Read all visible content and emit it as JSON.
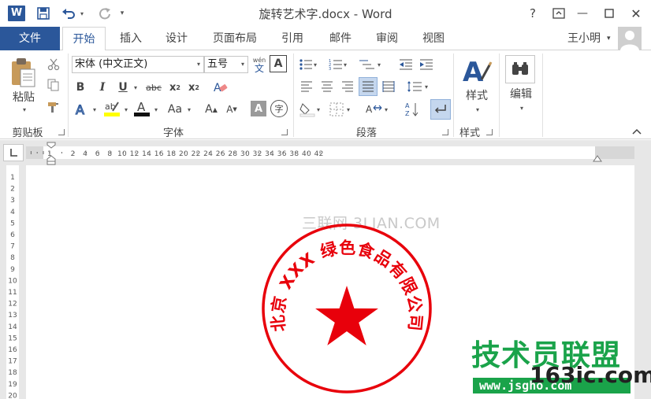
{
  "window": {
    "title": "旋转艺术字.docx - Word",
    "app_icon_letter": "W",
    "help": "?",
    "controls": {
      "minimize": "—",
      "restore": "❐",
      "close": "✕"
    }
  },
  "qat": {
    "customize": "▾"
  },
  "tabs": {
    "file": "文件",
    "items": [
      "开始",
      "插入",
      "设计",
      "页面布局",
      "引用",
      "邮件",
      "审阅",
      "视图"
    ],
    "active": "开始"
  },
  "user": {
    "name": "王小明"
  },
  "ribbon": {
    "clipboard": {
      "label": "剪贴板",
      "paste": "粘贴"
    },
    "font": {
      "label": "字体",
      "font_name": "宋体 (中文正文)",
      "font_size": "五号",
      "phonetic_top": "wén",
      "phonetic_char": "文",
      "border_char": "A",
      "enclose_char": "字"
    },
    "paragraph": {
      "label": "段落"
    },
    "styles": {
      "label": "样式",
      "button": "样式"
    },
    "editing": {
      "button": "编辑"
    }
  },
  "ruler": {
    "horizontal": "L 1 · 2 · 4 · 6 · 8 · 10 · 12 · 14 · 16 · 18 · 20 · 22 · 24 · 26 · 28 · 30 · 32 · 34 · 36 · 38 · 40 · 42",
    "vertical": [
      "1",
      "2",
      "3",
      "4",
      "5",
      "6",
      "7",
      "8",
      "9",
      "10",
      "11",
      "12",
      "13",
      "14",
      "15",
      "16",
      "17",
      "18",
      "19",
      "20"
    ]
  },
  "document": {
    "watermark": "三联网 3LIAN.COM",
    "seal_text": "北京 XXX 绿色食品有限公司",
    "seal_color": "#e8000b"
  },
  "site_watermark": {
    "big": "技术员联盟",
    "domain": "163ic.com",
    "small": "www.jsgho.com"
  }
}
